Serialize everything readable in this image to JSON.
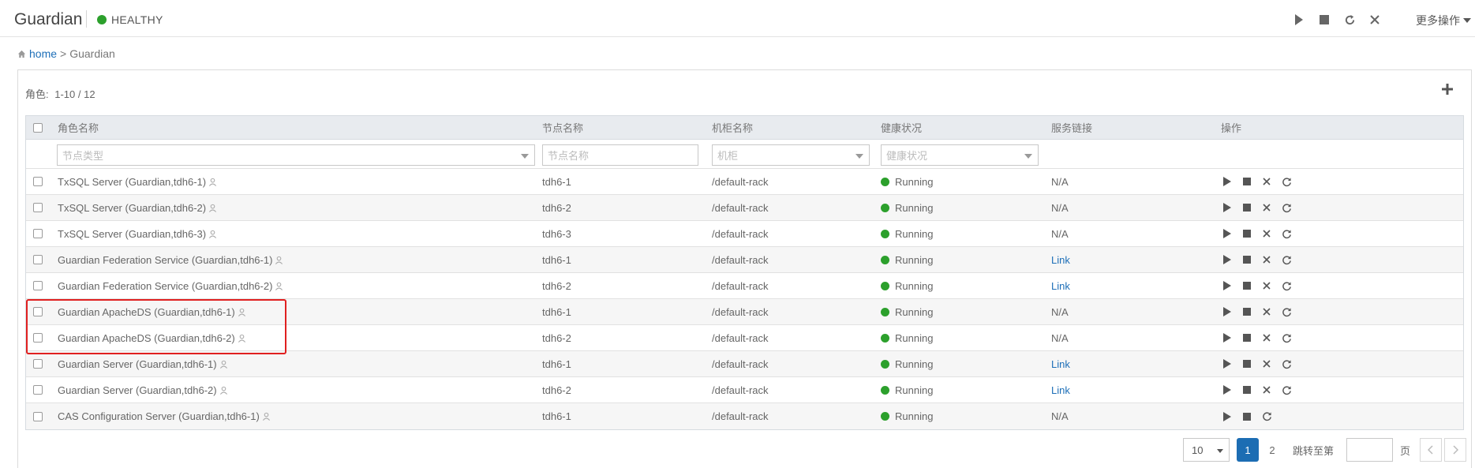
{
  "app": {
    "title": "Guardian",
    "health_status": "HEALTHY",
    "health_color": "#2ca02c",
    "more_actions": "更多操作"
  },
  "breadcrumb": {
    "home": "home",
    "separator": ">",
    "current": "Guardian"
  },
  "panel": {
    "role_count_label": "角色:",
    "role_count_range": "1-10 / 12"
  },
  "table": {
    "columns": [
      "角色名称",
      "节点名称",
      "机柜名称",
      "健康状况",
      "服务链接",
      "操作"
    ],
    "filters": {
      "role_type_placeholder": "节点类型",
      "node_name_placeholder": "节点名称",
      "rack_placeholder": "机柜",
      "health_placeholder": "健康状况"
    },
    "rows": [
      {
        "role": "TxSQL Server (Guardian,tdh6-1)",
        "node": "tdh6-1",
        "rack": "/default-rack",
        "health": "Running",
        "link": "N/A"
      },
      {
        "role": "TxSQL Server (Guardian,tdh6-2)",
        "node": "tdh6-2",
        "rack": "/default-rack",
        "health": "Running",
        "link": "N/A"
      },
      {
        "role": "TxSQL Server (Guardian,tdh6-3)",
        "node": "tdh6-3",
        "rack": "/default-rack",
        "health": "Running",
        "link": "N/A"
      },
      {
        "role": "Guardian Federation Service (Guardian,tdh6-1)",
        "node": "tdh6-1",
        "rack": "/default-rack",
        "health": "Running",
        "link": "Link"
      },
      {
        "role": "Guardian Federation Service (Guardian,tdh6-2)",
        "node": "tdh6-2",
        "rack": "/default-rack",
        "health": "Running",
        "link": "Link"
      },
      {
        "role": "Guardian ApacheDS (Guardian,tdh6-1)",
        "node": "tdh6-1",
        "rack": "/default-rack",
        "health": "Running",
        "link": "N/A"
      },
      {
        "role": "Guardian ApacheDS (Guardian,tdh6-2)",
        "node": "tdh6-2",
        "rack": "/default-rack",
        "health": "Running",
        "link": "N/A"
      },
      {
        "role": "Guardian Server (Guardian,tdh6-1)",
        "node": "tdh6-1",
        "rack": "/default-rack",
        "health": "Running",
        "link": "Link"
      },
      {
        "role": "Guardian Server (Guardian,tdh6-2)",
        "node": "tdh6-2",
        "rack": "/default-rack",
        "health": "Running",
        "link": "Link"
      },
      {
        "role": "CAS Configuration Server (Guardian,tdh6-1)",
        "node": "tdh6-1",
        "rack": "/default-rack",
        "health": "Running",
        "link": "N/A"
      }
    ]
  },
  "pagination": {
    "page_size": "10",
    "pages": [
      "1",
      "2"
    ],
    "current_page": "1",
    "jump_label": "跳转至第",
    "page_suffix": "页"
  },
  "colors": {
    "accent": "#1c6db3",
    "link": "#1e6fb8",
    "running": "#2ca02c",
    "highlight": "#e02020"
  }
}
